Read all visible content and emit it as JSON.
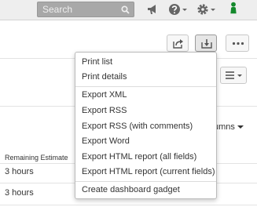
{
  "topbar": {
    "search_placeholder": "Search",
    "icons": [
      "search-icon",
      "megaphone-icon",
      "help-icon",
      "gear-icon",
      "user-icon"
    ]
  },
  "toolbar": {
    "share_icon": "share-icon",
    "export_icon": "export-icon",
    "more_icon": "more-icon",
    "view_icon": "list-view-icon"
  },
  "columns_label": "umns",
  "table": {
    "column_header": "Remaining Estimate",
    "rows": [
      "3 hours",
      "3 hours"
    ]
  },
  "export_menu": {
    "groups": [
      [
        "Print list",
        "Print details"
      ],
      [
        "Export XML",
        "Export RSS",
        "Export RSS (with comments)",
        "Export Word",
        "Export HTML report (all fields)",
        "Export HTML report (current fields)"
      ],
      [
        "Create dashboard gadget"
      ]
    ]
  },
  "colors": {
    "topbar_bg": "#eeeeee",
    "search_bg": "#a8a8a8",
    "avatar_green": "#14892c"
  }
}
